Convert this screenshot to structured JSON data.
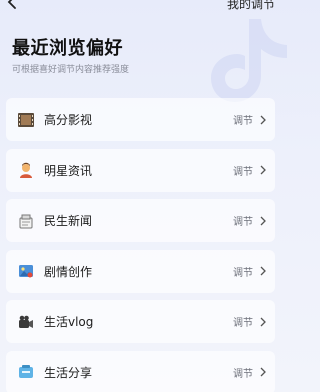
{
  "header": {
    "right_link": "我的调节"
  },
  "title": "最近浏览偏好",
  "subtitle": "可根据喜好调节内容推荐强度",
  "items": [
    {
      "label": "高分影视",
      "action": "调节",
      "icon": "film-strip-icon"
    },
    {
      "label": "明星资讯",
      "action": "调节",
      "icon": "celebrity-icon"
    },
    {
      "label": "民生新闻",
      "action": "调节",
      "icon": "news-icon"
    },
    {
      "label": "剧情创作",
      "action": "调节",
      "icon": "picture-icon"
    },
    {
      "label": "生活vlog",
      "action": "调节",
      "icon": "video-camera-icon"
    },
    {
      "label": "生活分享",
      "action": "调节",
      "icon": "share-icon"
    }
  ]
}
